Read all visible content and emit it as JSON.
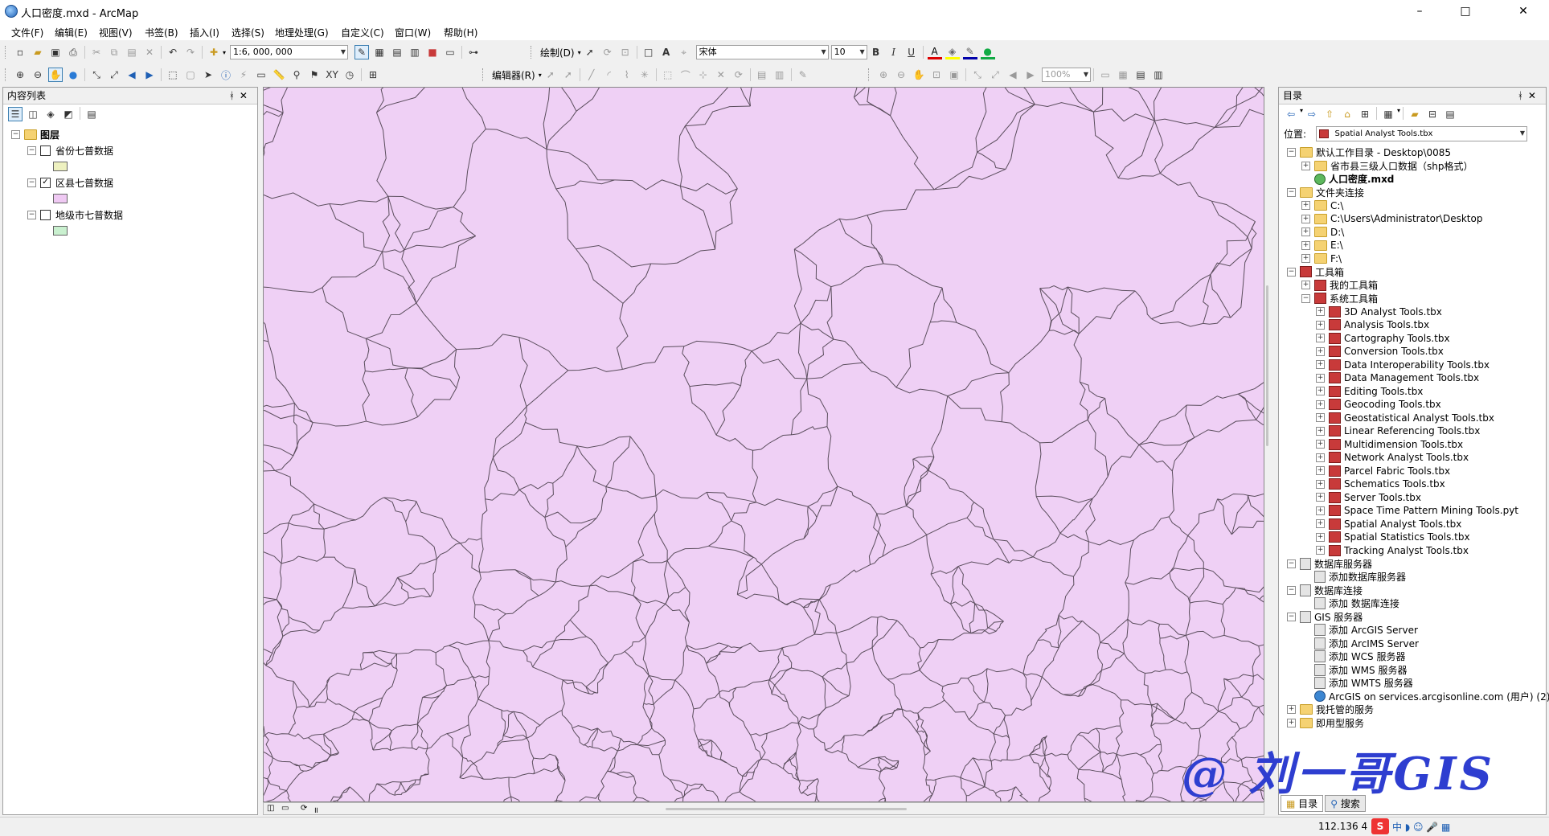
{
  "window": {
    "title": "人口密度.mxd - ArcMap",
    "min": "–",
    "max": "□",
    "close": "✕"
  },
  "menu": [
    "文件(F)",
    "编辑(E)",
    "视图(V)",
    "书签(B)",
    "插入(I)",
    "选择(S)",
    "地理处理(G)",
    "自定义(C)",
    "窗口(W)",
    "帮助(H)"
  ],
  "toolbar": {
    "scale": "1:6, 000, 000",
    "draw_label": "绘制(D)",
    "font_name": "宋体",
    "font_size": "10",
    "bold": "B",
    "italic": "I",
    "underline": "U",
    "editor_label": "编辑器(R)",
    "zoom": "100%"
  },
  "toc": {
    "title": "内容列表",
    "root": "图层",
    "layers": [
      {
        "name": "省份七普数据",
        "checked": false,
        "color": "#eef1c0"
      },
      {
        "name": "区县七普数据",
        "checked": true,
        "color": "#efc9f3"
      },
      {
        "name": "地级市七普数据",
        "checked": false,
        "color": "#c9f0cf"
      }
    ],
    "check_mark": "✓"
  },
  "catalog": {
    "title": "目录",
    "location_label": "位置:",
    "location_value": "Spatial Analyst Tools.tbx",
    "items": [
      {
        "label": "默认工作目录 - Desktop\\0085",
        "level": 0,
        "icon": "folder-icon",
        "exp": "−"
      },
      {
        "label": "省市县三级人口数据（shp格式）",
        "level": 1,
        "icon": "folder-icon",
        "exp": "+"
      },
      {
        "label": "人口密度.mxd",
        "level": 1,
        "icon": "mxd-icon",
        "exp": "",
        "bold": true
      },
      {
        "label": "文件夹连接",
        "level": 0,
        "icon": "folder-icon",
        "exp": "−"
      },
      {
        "label": "C:\\",
        "level": 1,
        "icon": "folder-icon",
        "exp": "+"
      },
      {
        "label": "C:\\Users\\Administrator\\Desktop",
        "level": 1,
        "icon": "folder-icon",
        "exp": "+"
      },
      {
        "label": "D:\\",
        "level": 1,
        "icon": "folder-icon",
        "exp": "+"
      },
      {
        "label": "E:\\",
        "level": 1,
        "icon": "folder-icon",
        "exp": "+"
      },
      {
        "label": "F:\\",
        "level": 1,
        "icon": "folder-icon",
        "exp": "+"
      },
      {
        "label": "工具箱",
        "level": 0,
        "icon": "toolbox-icon",
        "exp": "−"
      },
      {
        "label": "我的工具箱",
        "level": 1,
        "icon": "toolbox-icon",
        "exp": "+"
      },
      {
        "label": "系统工具箱",
        "level": 1,
        "icon": "toolbox-icon",
        "exp": "−"
      },
      {
        "label": "3D Analyst Tools.tbx",
        "level": 2,
        "icon": "toolbox-icon",
        "exp": "+"
      },
      {
        "label": "Analysis Tools.tbx",
        "level": 2,
        "icon": "toolbox-icon",
        "exp": "+"
      },
      {
        "label": "Cartography Tools.tbx",
        "level": 2,
        "icon": "toolbox-icon",
        "exp": "+"
      },
      {
        "label": "Conversion Tools.tbx",
        "level": 2,
        "icon": "toolbox-icon",
        "exp": "+"
      },
      {
        "label": "Data Interoperability Tools.tbx",
        "level": 2,
        "icon": "toolbox-icon",
        "exp": "+"
      },
      {
        "label": "Data Management Tools.tbx",
        "level": 2,
        "icon": "toolbox-icon",
        "exp": "+"
      },
      {
        "label": "Editing Tools.tbx",
        "level": 2,
        "icon": "toolbox-icon",
        "exp": "+"
      },
      {
        "label": "Geocoding Tools.tbx",
        "level": 2,
        "icon": "toolbox-icon",
        "exp": "+"
      },
      {
        "label": "Geostatistical Analyst Tools.tbx",
        "level": 2,
        "icon": "toolbox-icon",
        "exp": "+"
      },
      {
        "label": "Linear Referencing Tools.tbx",
        "level": 2,
        "icon": "toolbox-icon",
        "exp": "+"
      },
      {
        "label": "Multidimension Tools.tbx",
        "level": 2,
        "icon": "toolbox-icon",
        "exp": "+"
      },
      {
        "label": "Network Analyst Tools.tbx",
        "level": 2,
        "icon": "toolbox-icon",
        "exp": "+"
      },
      {
        "label": "Parcel Fabric Tools.tbx",
        "level": 2,
        "icon": "toolbox-icon",
        "exp": "+"
      },
      {
        "label": "Schematics Tools.tbx",
        "level": 2,
        "icon": "toolbox-icon",
        "exp": "+"
      },
      {
        "label": "Server Tools.tbx",
        "level": 2,
        "icon": "toolbox-icon",
        "exp": "+"
      },
      {
        "label": "Space Time Pattern Mining Tools.pyt",
        "level": 2,
        "icon": "toolbox-icon",
        "exp": "+"
      },
      {
        "label": "Spatial Analyst Tools.tbx",
        "level": 2,
        "icon": "toolbox-icon",
        "exp": "+"
      },
      {
        "label": "Spatial Statistics Tools.tbx",
        "level": 2,
        "icon": "toolbox-icon",
        "exp": "+"
      },
      {
        "label": "Tracking Analyst Tools.tbx",
        "level": 2,
        "icon": "toolbox-icon",
        "exp": "+"
      },
      {
        "label": "数据库服务器",
        "level": 0,
        "icon": "server-icon",
        "exp": "−"
      },
      {
        "label": "添加数据库服务器",
        "level": 1,
        "icon": "server-icon",
        "exp": ""
      },
      {
        "label": "数据库连接",
        "level": 0,
        "icon": "server-icon",
        "exp": "−"
      },
      {
        "label": "添加 数据库连接",
        "level": 1,
        "icon": "server-icon",
        "exp": ""
      },
      {
        "label": "GIS 服务器",
        "level": 0,
        "icon": "server-icon",
        "exp": "−"
      },
      {
        "label": "添加 ArcGIS Server",
        "level": 1,
        "icon": "server-icon",
        "exp": ""
      },
      {
        "label": "添加 ArcIMS Server",
        "level": 1,
        "icon": "server-icon",
        "exp": ""
      },
      {
        "label": "添加 WCS 服务器",
        "level": 1,
        "icon": "server-icon",
        "exp": ""
      },
      {
        "label": "添加 WMS 服务器",
        "level": 1,
        "icon": "server-icon",
        "exp": ""
      },
      {
        "label": "添加 WMTS 服务器",
        "level": 1,
        "icon": "server-icon",
        "exp": ""
      },
      {
        "label": "ArcGIS on services.arcgisonline.com (用户) (2)",
        "level": 1,
        "icon": "globe-icon",
        "exp": ""
      },
      {
        "label": "我托管的服务",
        "level": 0,
        "icon": "folder-icon",
        "exp": "+"
      },
      {
        "label": "即用型服务",
        "level": 0,
        "icon": "folder-icon",
        "exp": "+"
      }
    ],
    "tabs": [
      "目录",
      "搜索"
    ]
  },
  "status": {
    "coord": "112.136  4"
  },
  "watermark": "@ 刘一哥GIS"
}
